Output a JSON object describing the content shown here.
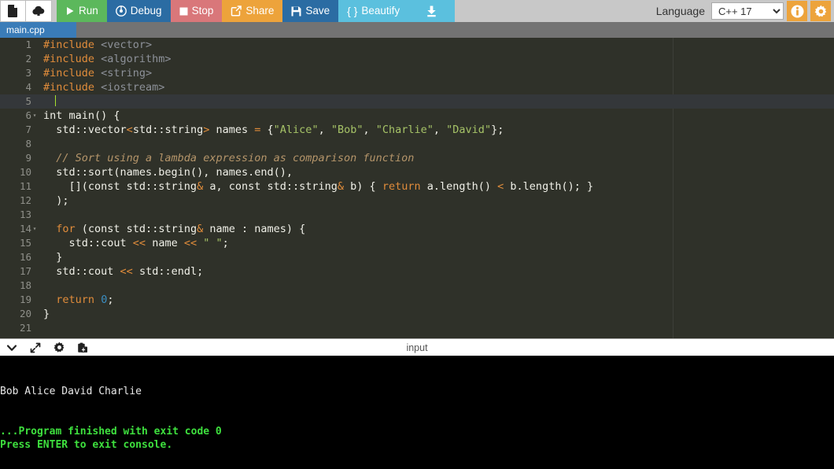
{
  "toolbar": {
    "new_file_icon": "document-icon",
    "upload_icon": "cloud-upload-icon",
    "buttons": [
      {
        "label": "Run",
        "icon": "play-icon",
        "color": "#5cb85c"
      },
      {
        "label": "Debug",
        "icon": "debug-icon",
        "color": "#2b6ca3"
      },
      {
        "label": "Stop",
        "icon": "stop-icon",
        "color": "#d9777a"
      },
      {
        "label": "Share",
        "icon": "share-icon",
        "color": "#eda33b"
      },
      {
        "label": "Save",
        "icon": "floppy-icon",
        "color": "#2b6ca3"
      },
      {
        "label": "Beautify",
        "icon": "braces-icon",
        "color": "#5bc0de"
      }
    ],
    "download_icon": "download-icon",
    "language_label": "Language",
    "language_value": "C++ 17",
    "language_options": [
      "C++ 17"
    ],
    "info_icon": "info-icon",
    "settings_icon": "gear-icon"
  },
  "tabs": [
    {
      "label": "main.cpp",
      "active": true
    }
  ],
  "editor": {
    "active_line": 5,
    "total_lines": 21,
    "lines": [
      {
        "n": 1,
        "fold": false,
        "tokens": [
          {
            "t": "#include ",
            "c": "k-pre"
          },
          {
            "t": "<vector>",
            "c": "k-hdr"
          }
        ]
      },
      {
        "n": 2,
        "fold": false,
        "tokens": [
          {
            "t": "#include ",
            "c": "k-pre"
          },
          {
            "t": "<algorithm>",
            "c": "k-hdr"
          }
        ]
      },
      {
        "n": 3,
        "fold": false,
        "tokens": [
          {
            "t": "#include ",
            "c": "k-pre"
          },
          {
            "t": "<string>",
            "c": "k-hdr"
          }
        ]
      },
      {
        "n": 4,
        "fold": false,
        "tokens": [
          {
            "t": "#include ",
            "c": "k-pre"
          },
          {
            "t": "<iostream>",
            "c": "k-hdr"
          }
        ]
      },
      {
        "n": 5,
        "fold": false,
        "tokens": []
      },
      {
        "n": 6,
        "fold": true,
        "tokens": [
          {
            "t": "int main() {",
            "c": "k-plain"
          }
        ]
      },
      {
        "n": 7,
        "fold": false,
        "tokens": [
          {
            "t": "  std::vector",
            "c": "k-plain"
          },
          {
            "t": "<",
            "c": "k-op"
          },
          {
            "t": "std::string",
            "c": "k-plain"
          },
          {
            "t": ">",
            "c": "k-op"
          },
          {
            "t": " names ",
            "c": "k-plain"
          },
          {
            "t": "=",
            "c": "k-op"
          },
          {
            "t": " {",
            "c": "k-plain"
          },
          {
            "t": "\"Alice\"",
            "c": "k-str"
          },
          {
            "t": ", ",
            "c": "k-plain"
          },
          {
            "t": "\"Bob\"",
            "c": "k-str"
          },
          {
            "t": ", ",
            "c": "k-plain"
          },
          {
            "t": "\"Charlie\"",
            "c": "k-str"
          },
          {
            "t": ", ",
            "c": "k-plain"
          },
          {
            "t": "\"David\"",
            "c": "k-str"
          },
          {
            "t": "};",
            "c": "k-plain"
          }
        ]
      },
      {
        "n": 8,
        "fold": false,
        "tokens": []
      },
      {
        "n": 9,
        "fold": false,
        "tokens": [
          {
            "t": "  // Sort using a lambda expression as comparison function",
            "c": "k-cmt"
          }
        ]
      },
      {
        "n": 10,
        "fold": false,
        "tokens": [
          {
            "t": "  std::sort(names.begin(), names.end(),",
            "c": "k-plain"
          }
        ]
      },
      {
        "n": 11,
        "fold": false,
        "tokens": [
          {
            "t": "    [](const std::string",
            "c": "k-plain"
          },
          {
            "t": "&",
            "c": "k-op"
          },
          {
            "t": " a, const std::string",
            "c": "k-plain"
          },
          {
            "t": "&",
            "c": "k-op"
          },
          {
            "t": " b) { ",
            "c": "k-plain"
          },
          {
            "t": "return",
            "c": "k-kw"
          },
          {
            "t": " a.length() ",
            "c": "k-plain"
          },
          {
            "t": "<",
            "c": "k-op"
          },
          {
            "t": " b.length(); }",
            "c": "k-plain"
          }
        ]
      },
      {
        "n": 12,
        "fold": false,
        "tokens": [
          {
            "t": "  );",
            "c": "k-plain"
          }
        ]
      },
      {
        "n": 13,
        "fold": false,
        "tokens": []
      },
      {
        "n": 14,
        "fold": true,
        "tokens": [
          {
            "t": "  ",
            "c": "k-plain"
          },
          {
            "t": "for",
            "c": "k-kw"
          },
          {
            "t": " (const std::string",
            "c": "k-plain"
          },
          {
            "t": "&",
            "c": "k-op"
          },
          {
            "t": " name : names) {",
            "c": "k-plain"
          }
        ]
      },
      {
        "n": 15,
        "fold": false,
        "tokens": [
          {
            "t": "    std::cout ",
            "c": "k-plain"
          },
          {
            "t": "<<",
            "c": "k-op"
          },
          {
            "t": " name ",
            "c": "k-plain"
          },
          {
            "t": "<<",
            "c": "k-op"
          },
          {
            "t": " ",
            "c": "k-plain"
          },
          {
            "t": "\" \"",
            "c": "k-str"
          },
          {
            "t": ";",
            "c": "k-plain"
          }
        ]
      },
      {
        "n": 16,
        "fold": false,
        "tokens": [
          {
            "t": "  }",
            "c": "k-plain"
          }
        ]
      },
      {
        "n": 17,
        "fold": false,
        "tokens": [
          {
            "t": "  std::cout ",
            "c": "k-plain"
          },
          {
            "t": "<<",
            "c": "k-op"
          },
          {
            "t": " std::endl;",
            "c": "k-plain"
          }
        ]
      },
      {
        "n": 18,
        "fold": false,
        "tokens": []
      },
      {
        "n": 19,
        "fold": false,
        "tokens": [
          {
            "t": "  ",
            "c": "k-plain"
          },
          {
            "t": "return",
            "c": "k-kw"
          },
          {
            "t": " ",
            "c": "k-plain"
          },
          {
            "t": "0",
            "c": "k-num"
          },
          {
            "t": ";",
            "c": "k-plain"
          }
        ]
      },
      {
        "n": 20,
        "fold": false,
        "tokens": [
          {
            "t": "}",
            "c": "k-plain"
          }
        ]
      },
      {
        "n": 21,
        "fold": false,
        "tokens": []
      }
    ]
  },
  "console_header": {
    "icons": [
      "chevron-down-icon",
      "expand-arrows-icon",
      "gear-icon",
      "paste-icon"
    ],
    "title": "input"
  },
  "console": {
    "lines": [
      {
        "text": "Bob Alice David Charlie",
        "style": "out-line"
      },
      {
        "text": "",
        "style": "out-blank"
      },
      {
        "text": "",
        "style": "out-blank"
      },
      {
        "text": "...Program finished with exit code 0",
        "style": "out-green"
      },
      {
        "text": "Press ENTER to exit console.",
        "style": "out-green"
      }
    ]
  },
  "colors": {
    "toolbar_bg": "#c8c8c8",
    "tab_active": "#3a7cb8",
    "tabbar_bg": "#737373",
    "editor_bg": "#2f3129",
    "console_bg": "#000000",
    "accent_orange": "#eda33b",
    "accent_green": "#5cb85c",
    "accent_blue": "#2b6ca3"
  }
}
